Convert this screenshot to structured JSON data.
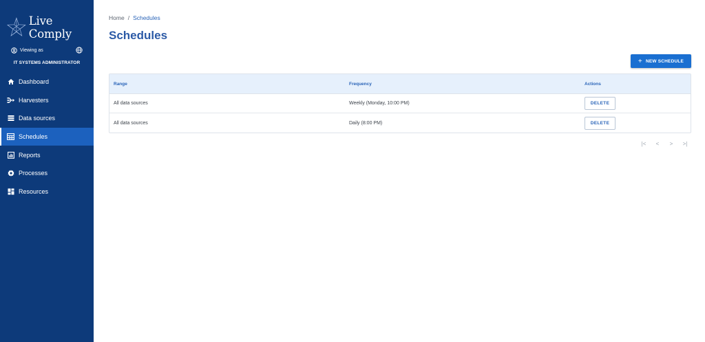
{
  "brand": {
    "name": "Live Comply"
  },
  "user": {
    "viewing_label": "Viewing as",
    "role": "IT SYSTEMS ADMINISTRATOR"
  },
  "sidebar": {
    "items": [
      {
        "label": "Dashboard",
        "icon": "home-icon"
      },
      {
        "label": "Harvesters",
        "icon": "harvester-icon"
      },
      {
        "label": "Data sources",
        "icon": "list-icon"
      },
      {
        "label": "Schedules",
        "icon": "grid-icon",
        "active": true
      },
      {
        "label": "Reports",
        "icon": "report-icon"
      },
      {
        "label": "Processes",
        "icon": "gear-icon"
      },
      {
        "label": "Resources",
        "icon": "dashboard-blocks-icon"
      }
    ]
  },
  "breadcrumb": {
    "home": "Home",
    "separator": "/",
    "current": "Schedules"
  },
  "page": {
    "title": "Schedules"
  },
  "toolbar": {
    "new_label": "NEW SCHEDULE"
  },
  "table": {
    "headers": [
      "Range",
      "Frequency",
      "Actions"
    ],
    "rows": [
      {
        "range": "All data sources",
        "frequency": "Weekly (Monday, 10:00 PM)",
        "action": "DELETE"
      },
      {
        "range": "All data sources",
        "frequency": "Daily (8:00 PM)",
        "action": "DELETE"
      }
    ]
  },
  "pagination": {
    "first": "|<",
    "prev": "<",
    "next": ">",
    "last": ">|"
  },
  "colors": {
    "sidebar": "#0d3a7a",
    "active": "#1c61be",
    "primary": "#1a6fd1",
    "title": "#2c5aa6"
  }
}
